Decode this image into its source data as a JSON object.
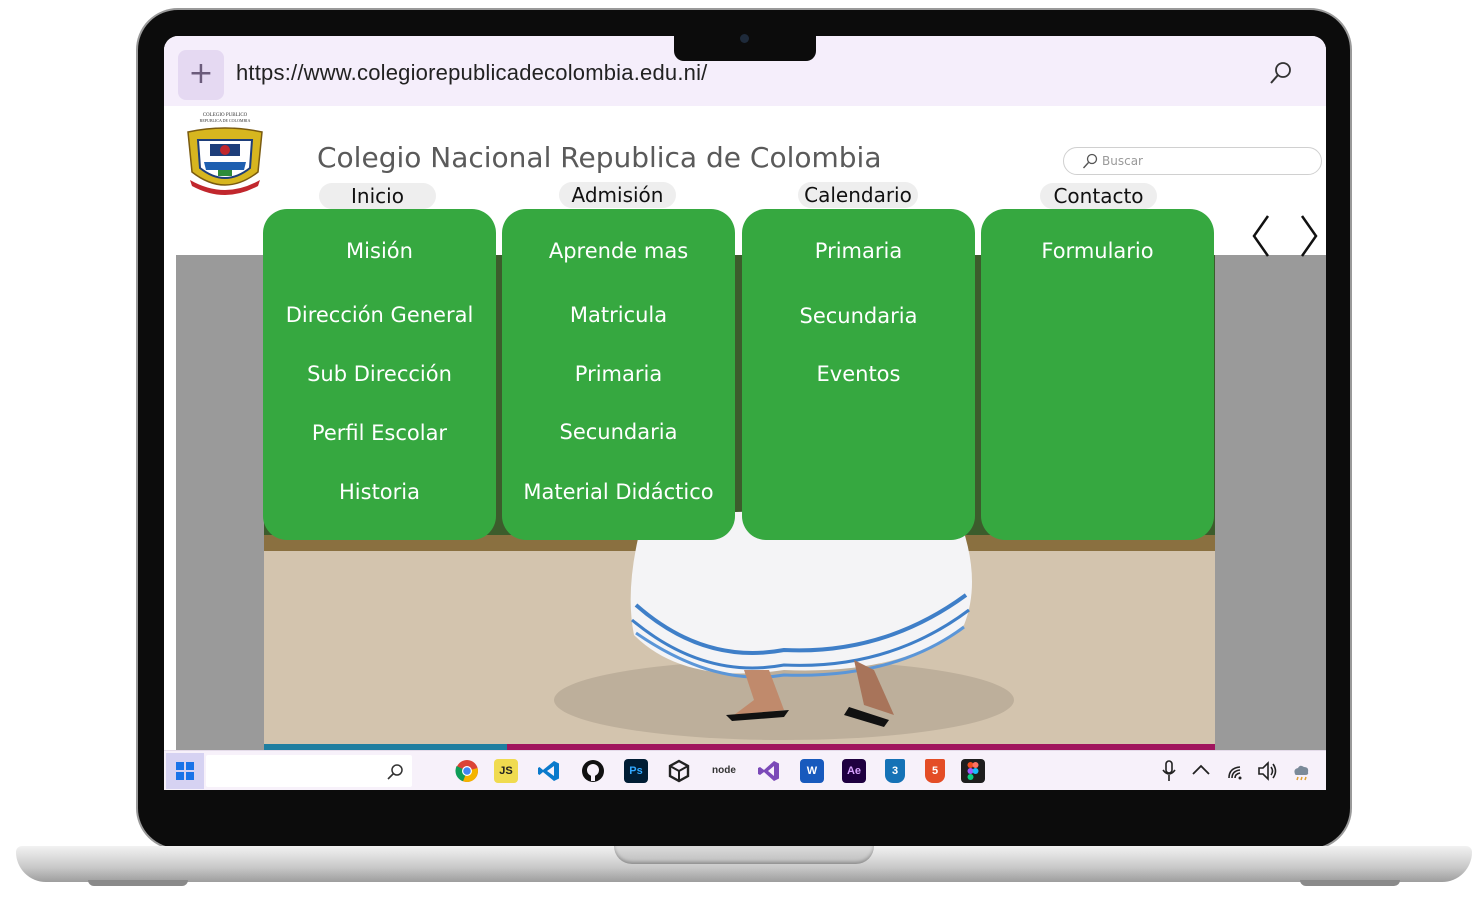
{
  "browser": {
    "url": "https://www.colegiorepublicadecolombia.edu.ni/",
    "new_tab_icon": "plus-icon",
    "search_icon": "search-icon"
  },
  "site": {
    "title": "Colegio Nacional Republica de Colombia",
    "logo_top_text": "COLEGIO PUBLICO",
    "logo_sub_text": "REPUBLICA DE COLOMBIA",
    "search_placeholder": "Buscar"
  },
  "nav": [
    {
      "label": "Inicio",
      "items": [
        "Misión",
        "Dirección General",
        "Sub Dirección",
        "Perfil Escolar",
        "Historia"
      ]
    },
    {
      "label": "Admisión",
      "items": [
        "Aprende mas",
        "Matricula",
        "Primaria",
        "Secundaria",
        "Material Didáctico"
      ]
    },
    {
      "label": "Calendario",
      "items": [
        "Primaria",
        "Secundaria",
        "Eventos"
      ]
    },
    {
      "label": "Contacto",
      "items": [
        "Formulario"
      ]
    }
  ],
  "slider": {
    "prev_icon": "chevron-left-icon",
    "next_icon": "chevron-right-icon"
  },
  "colors": {
    "menu_green": "#36a840",
    "browser_bar": "#f5eefb",
    "progress_blue": "#1e7ea0",
    "progress_magenta": "#a0155e"
  },
  "taskbar": {
    "start_icon": "windows-start-icon",
    "search_icon": "search-icon",
    "apps": [
      {
        "name": "chrome-icon",
        "label": ""
      },
      {
        "name": "javascript-icon",
        "label": "JS"
      },
      {
        "name": "vscode-icon",
        "label": ""
      },
      {
        "name": "github-icon",
        "label": ""
      },
      {
        "name": "photoshop-icon",
        "label": "Ps"
      },
      {
        "name": "unity-icon",
        "label": ""
      },
      {
        "name": "nodejs-icon",
        "label": "node"
      },
      {
        "name": "visual-studio-icon",
        "label": ""
      },
      {
        "name": "word-icon",
        "label": "W"
      },
      {
        "name": "after-effects-icon",
        "label": "Ae"
      },
      {
        "name": "css3-icon",
        "label": "3"
      },
      {
        "name": "html5-icon",
        "label": "5"
      },
      {
        "name": "figma-icon",
        "label": ""
      }
    ],
    "tray": [
      "microphone-icon",
      "chevron-up-icon",
      "wifi-icon",
      "volume-icon",
      "weather-icon"
    ]
  }
}
